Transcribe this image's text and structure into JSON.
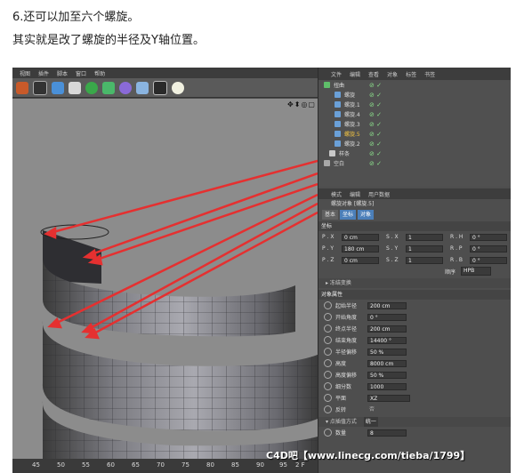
{
  "captions": {
    "line1": "6.还可以加至六个螺旋。",
    "line2": "其实就是改了螺旋的半径及Y轴位置。"
  },
  "menubar": [
    "文件",
    "编辑",
    "查看",
    "对象",
    "标签",
    "书签"
  ],
  "viewport_menu": [
    "视图",
    "插件",
    "脚本",
    "窗口",
    "帮助"
  ],
  "timeline": {
    "ticks": [
      "45",
      "50",
      "55",
      "60",
      "65",
      "70",
      "75",
      "80",
      "85",
      "90",
      "95"
    ],
    "frame": "2 F"
  },
  "object_manager": {
    "tabs": [
      "文件",
      "编辑",
      "查看",
      "对象",
      "标签",
      "书签"
    ],
    "objects": [
      {
        "name": "扭曲",
        "selected": false
      },
      {
        "name": "螺旋",
        "selected": false
      },
      {
        "name": "螺旋.1",
        "selected": false
      },
      {
        "name": "螺旋.4",
        "selected": false
      },
      {
        "name": "螺旋.3",
        "selected": false
      },
      {
        "name": "螺旋.5",
        "selected": true
      },
      {
        "name": "螺旋.2",
        "selected": false
      },
      {
        "name": "样条",
        "selected": false
      },
      {
        "name": "空白",
        "selected": false
      }
    ]
  },
  "attributes": {
    "menu": [
      "模式",
      "编辑",
      "用户数据"
    ],
    "title": "螺旋对象 [螺旋.5]",
    "tabs": [
      {
        "label": "基本",
        "on": false
      },
      {
        "label": "坐标",
        "on": true
      },
      {
        "label": "对象",
        "on": true
      }
    ],
    "coord_section": "坐标",
    "coords": [
      {
        "p_label": "P . X",
        "p_val": "0 cm",
        "s_label": "S . X",
        "s_val": "1",
        "r_label": "R . H",
        "r_val": "0 °"
      },
      {
        "p_label": "P . Y",
        "p_val": "180 cm",
        "s_label": "S . Y",
        "s_val": "1",
        "r_label": "R . P",
        "r_val": "0 °"
      },
      {
        "p_label": "P . Z",
        "p_val": "0 cm",
        "s_label": "S . Z",
        "s_val": "1",
        "r_label": "R . B",
        "r_val": "0 °"
      }
    ],
    "order_label": "顺序",
    "order_value": "HPB",
    "freeze_label": "冻结变换",
    "object_section": "对象属性",
    "props": [
      {
        "label": "起始半径",
        "value": "200 cm"
      },
      {
        "label": "开始角度",
        "value": "0 °"
      },
      {
        "label": "终点半径",
        "value": "200 cm"
      },
      {
        "label": "结束角度",
        "value": "14400 °"
      },
      {
        "label": "半径偏移",
        "value": "50 %"
      },
      {
        "label": "高度",
        "value": "8000 cm"
      },
      {
        "label": "高度偏移",
        "value": "50 %"
      },
      {
        "label": "细分数",
        "value": "1000"
      },
      {
        "label": "平面",
        "value": "XZ"
      },
      {
        "label": "反转",
        "value": "否"
      }
    ],
    "interp_label": "点插值方式",
    "interp_value": "统一",
    "count_label": "数量",
    "count_value": "8"
  },
  "watermark": "C4D吧【www.linecg.com/tieba/1799】",
  "colors": {
    "arrow": "#e53030",
    "selected_object": "#f4c542",
    "tab_active": "#4b7fb9"
  }
}
